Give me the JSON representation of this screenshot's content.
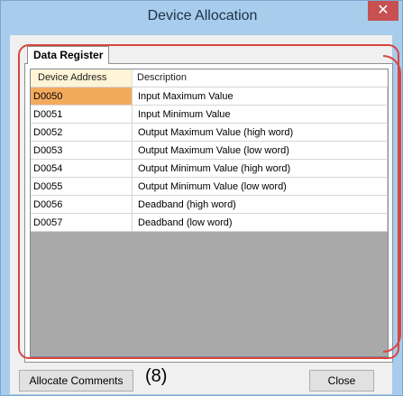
{
  "window": {
    "title": "Device Allocation",
    "close_glyph": "✕"
  },
  "tab": {
    "label": "Data Register"
  },
  "table": {
    "headers": {
      "address": "Device Address",
      "description": "Description"
    },
    "rows": [
      {
        "address": "D0050",
        "description": "Input Maximum Value",
        "selected": true
      },
      {
        "address": "D0051",
        "description": "Input Minimum Value"
      },
      {
        "address": "D0052",
        "description": "Output Maximum Value (high word)"
      },
      {
        "address": "D0053",
        "description": "Output Maximum Value (low word)"
      },
      {
        "address": "D0054",
        "description": "Output Minimum Value (high word)"
      },
      {
        "address": "D0055",
        "description": "Output Minimum Value (low word)"
      },
      {
        "address": "D0056",
        "description": "Deadband (high word)"
      },
      {
        "address": "D0057",
        "description": "Deadband (low word)"
      }
    ]
  },
  "buttons": {
    "allocate": "Allocate Comments",
    "close": "Close"
  },
  "callout": "(8)",
  "colors": {
    "selection": "#f2aa5d",
    "annotation": "#d9443f",
    "window_frame": "#a7ccec"
  }
}
